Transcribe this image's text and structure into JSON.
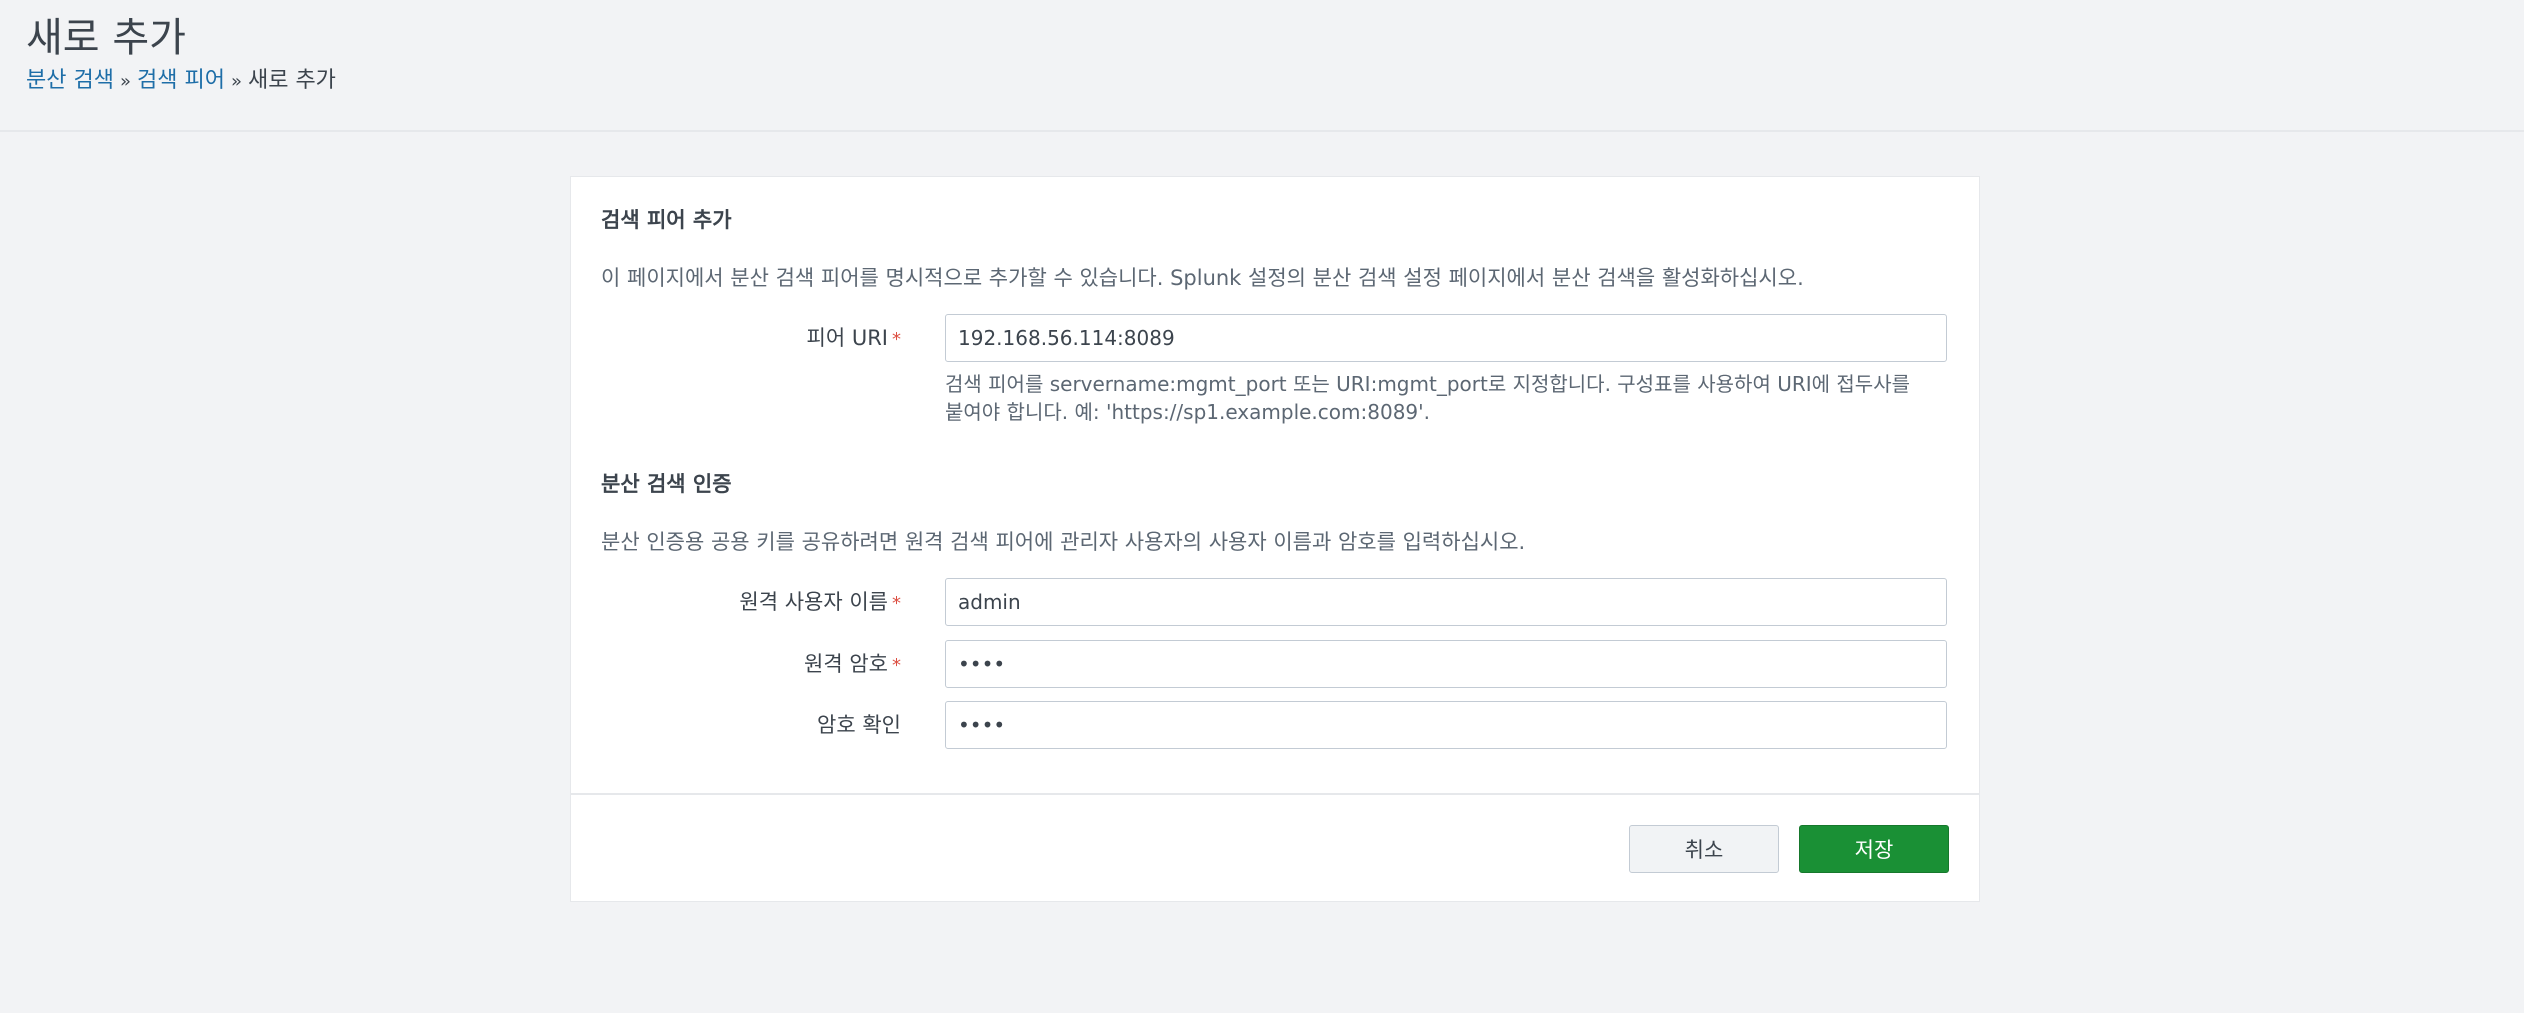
{
  "header": {
    "title": "새로 추가",
    "breadcrumb": {
      "item1": "분산 검색",
      "item2": "검색 피어",
      "separator": "»",
      "current": "새로 추가"
    }
  },
  "peer_section": {
    "title": "검색 피어 추가",
    "description": "이 페이지에서 분산 검색 피어를 명시적으로 추가할 수 있습니다. Splunk 설정의 분산 검색 설정 페이지에서 분산 검색을 활성화하십시오.",
    "uri_label": "피어 URI",
    "uri_value": "192.168.56.114:8089",
    "uri_help_line1": "검색 피어를 servername:mgmt_port 또는 URI:mgmt_port로 지정합니다. 구성표를 사용하여 URI에 접두사를",
    "uri_help_line2": "붙여야 합니다. 예: 'https://sp1.example.com:8089'."
  },
  "auth_section": {
    "title": "분산 검색 인증",
    "description": "분산 인증용 공용 키를 공유하려면 원격 검색 피어에 관리자 사용자의 사용자 이름과 암호를 입력하십시오.",
    "username_label": "원격 사용자 이름",
    "username_value": "admin",
    "password_label": "원격 암호",
    "password_value": "••••",
    "confirm_label": "암호 확인",
    "confirm_value": "••••"
  },
  "required_marker": "*",
  "buttons": {
    "cancel": "취소",
    "save": "저장"
  },
  "colors": {
    "link": "#1e6ea8",
    "save_button": "#1a9035",
    "required": "#dc4e41",
    "background": "#f2f3f5"
  }
}
